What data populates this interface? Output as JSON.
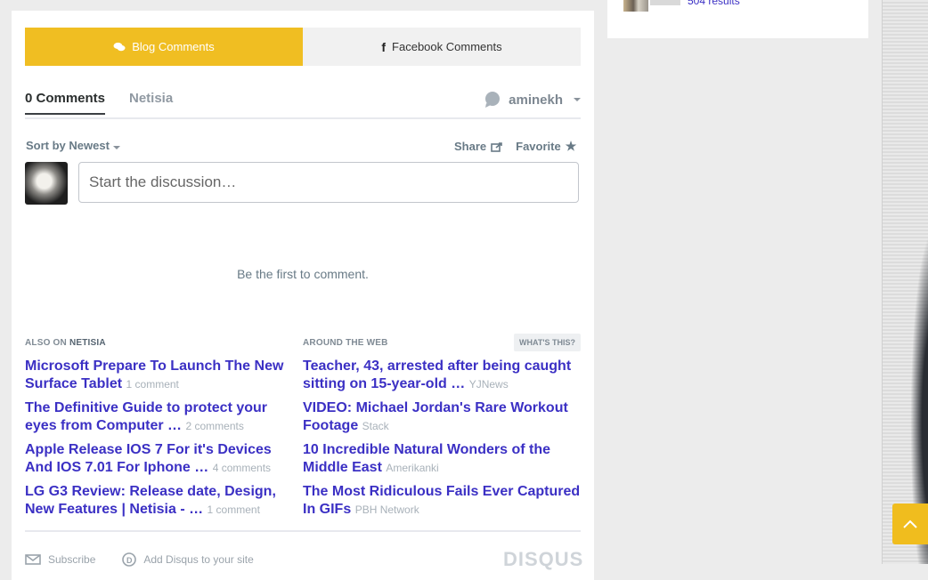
{
  "sidebar": {
    "link_text": "504 results"
  },
  "tabs": [
    {
      "label": "Blog Comments",
      "icon": "comments-icon"
    },
    {
      "label": "Facebook Comments",
      "icon": "facebook-icon"
    }
  ],
  "disqus": {
    "comment_count": "0 Comments",
    "forum_name": "Netisia",
    "username": "aminekh",
    "sort_label": "Sort by Newest",
    "share_label": "Share",
    "favorite_label": "Favorite",
    "compose_placeholder": "Start the discussion…",
    "empty_message": "Be the first to comment.",
    "also_on_prefix": "ALSO ON",
    "also_on_site": "NETISIA",
    "around_web": "AROUND THE WEB",
    "whats_this": "WHAT'S THIS?",
    "also_on_items": [
      {
        "title": "Microsoft Prepare To Launch The New Surface Tablet",
        "meta": "1 comment"
      },
      {
        "title": "The Definitive Guide to protect your eyes from Computer …",
        "meta": "2 comments"
      },
      {
        "title": "Apple Release IOS 7 For it's Devices And IOS 7.01 For Iphone …",
        "meta": "4 comments"
      },
      {
        "title": "LG G3 Review: Release date, Design, New Features | Netisia - …",
        "meta": "1 comment"
      }
    ],
    "around_web_items": [
      {
        "title": "Teacher, 43, arrested after being caught sitting on 15-year-old …",
        "meta": "YJNews"
      },
      {
        "title": "VIDEO: Michael Jordan's Rare Workout Footage",
        "meta": "Stack"
      },
      {
        "title": "10 Incredible Natural Wonders of the Middle East",
        "meta": "Amerikanki"
      },
      {
        "title": "The Most Ridiculous Fails Ever Captured In GIFs",
        "meta": "PBH Network"
      }
    ],
    "subscribe_label": "Subscribe",
    "add_disqus_label": "Add Disqus to your site",
    "logo_text": "DISQUS"
  },
  "colors": {
    "accent": "#f0be22",
    "link": "#3b30c4"
  }
}
